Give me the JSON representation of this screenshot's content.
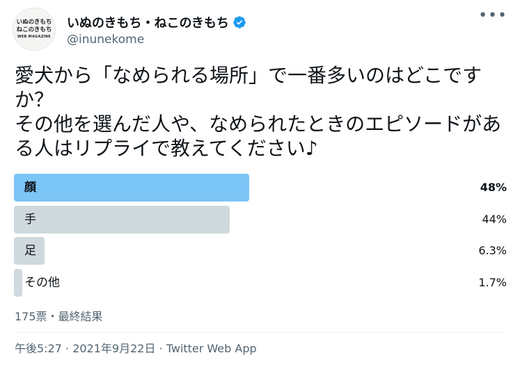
{
  "author": {
    "avatar_line1": "いぬのきもち",
    "avatar_line2": "ねこのきもち",
    "avatar_line3": "WEB MAGAZINE",
    "display_name": "いぬのきもち・ねこのきもち",
    "verified_icon": "verified-badge-icon",
    "handle": "@inunekome"
  },
  "more_icon": "more-dots-icon",
  "tweet": {
    "text": "愛犬から「なめられる場所」で一番多いのはどこですか？\nその他を選んだ人や、なめられたときのエピソードがある人はリプライで教えてください♪"
  },
  "poll": {
    "options": [
      {
        "label": "顔",
        "percent_label": "48%",
        "fill": 0.48
      },
      {
        "label": "手",
        "percent_label": "44%",
        "fill": 0.44
      },
      {
        "label": "足",
        "percent_label": "6.3%",
        "fill": 0.063
      },
      {
        "label": "その他",
        "percent_label": "1.7%",
        "fill": 0.017
      }
    ],
    "meta": "175票・最終結果"
  },
  "timestamp": "午後5:27 · 2021年9月22日 · Twitter Web App",
  "colors": {
    "winner_bar": "#7cc5f7",
    "bar": "#cfd9de",
    "verified": "#1d9bf0",
    "secondary_text": "#536471"
  }
}
